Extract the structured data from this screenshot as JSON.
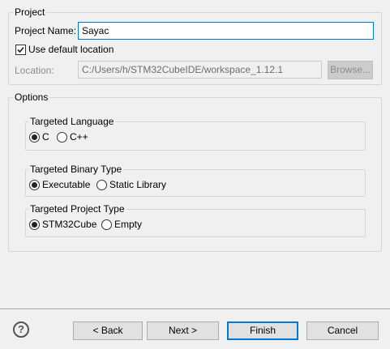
{
  "project": {
    "group_label": "Project",
    "name_label": "Project Name:",
    "name_value": "Sayac",
    "use_default_label": "Use default location",
    "use_default_checked": true,
    "location_label": "Location:",
    "location_value": "C:/Users/h/STM32CubeIDE/workspace_1.12.1",
    "browse_label": "Browse..."
  },
  "options": {
    "group_label": "Options",
    "language": {
      "label": "Targeted Language",
      "options": [
        "C",
        "C++"
      ],
      "selected": "C"
    },
    "binary_type": {
      "label": "Targeted Binary Type",
      "options": [
        "Executable",
        "Static Library"
      ],
      "selected": "Executable"
    },
    "project_type": {
      "label": "Targeted Project Type",
      "options": [
        "STM32Cube",
        "Empty"
      ],
      "selected": "STM32Cube"
    }
  },
  "footer": {
    "help_icon": "question-circle-icon",
    "back_label": "< Back",
    "next_label": "Next >",
    "finish_label": "Finish",
    "cancel_label": "Cancel"
  },
  "colors": {
    "background": "#f0f0f0",
    "focus_accent": "#0078d7",
    "disabled_text": "#8c8c8c"
  }
}
